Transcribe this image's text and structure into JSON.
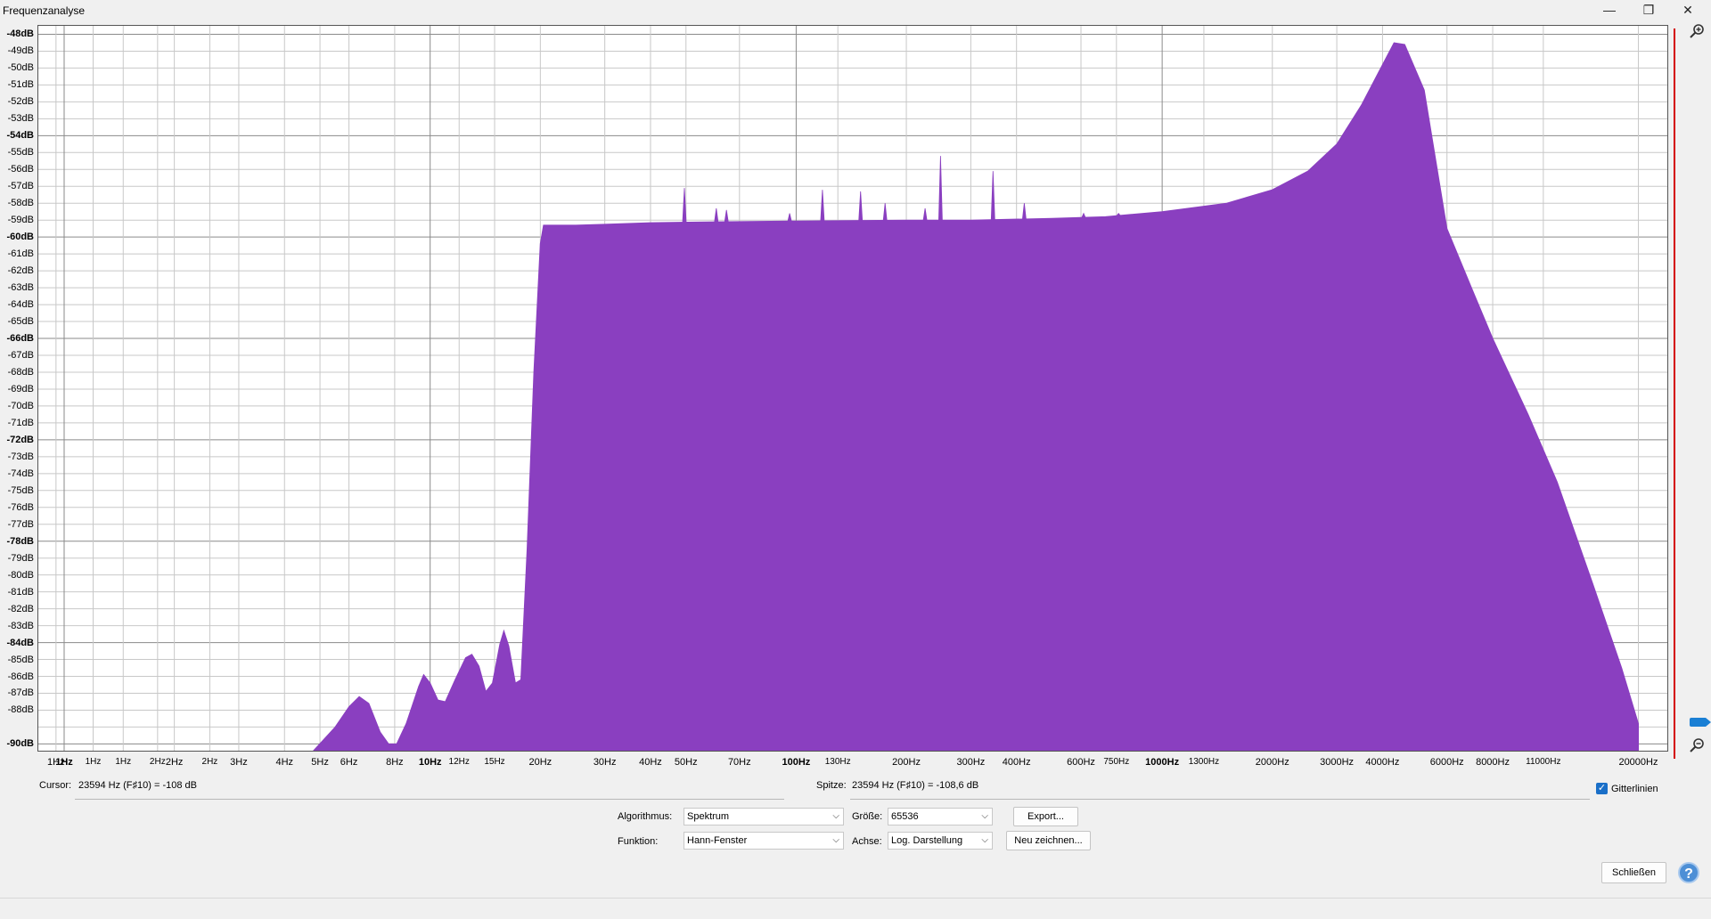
{
  "window": {
    "title": "Frequenzanalyse",
    "minimize_glyph": "—",
    "maximize_glyph": "❐",
    "close_glyph": "✕"
  },
  "chart_data": {
    "type": "area",
    "xscale": "log",
    "xlim": [
      0.85,
      24000
    ],
    "ylim": [
      -90.4,
      -47.5
    ],
    "grid": true,
    "fill_color": "#8a3fc0",
    "y_ticks": [
      "-48dB",
      "-49dB",
      "-50dB",
      "-51dB",
      "-52dB",
      "-53dB",
      "-54dB",
      "-55dB",
      "-56dB",
      "-57dB",
      "-58dB",
      "-59dB",
      "-60dB",
      "-61dB",
      "-62dB",
      "-63dB",
      "-64dB",
      "-65dB",
      "-66dB",
      "-67dB",
      "-68dB",
      "-69dB",
      "-70dB",
      "-71dB",
      "-72dB",
      "-73dB",
      "-74dB",
      "-75dB",
      "-76dB",
      "-77dB",
      "-78dB",
      "-79dB",
      "-80dB",
      "-81dB",
      "-82dB",
      "-83dB",
      "-84dB",
      "-85dB",
      "-86dB",
      "-87dB",
      "-88dB",
      "-90dB"
    ],
    "x_ticks": [
      {
        "f": 0.95,
        "label": "1Hz"
      },
      {
        "f": 1.0,
        "label": "1Hz",
        "major": true
      },
      {
        "f": 1.2,
        "label": "1Hz",
        "minor": true
      },
      {
        "f": 1.45,
        "label": "1Hz",
        "minor": true
      },
      {
        "f": 1.8,
        "label": "2Hz",
        "minor": true
      },
      {
        "f": 2.0,
        "label": "2Hz"
      },
      {
        "f": 2.5,
        "label": "2Hz",
        "minor": true
      },
      {
        "f": 3.0,
        "label": "3Hz"
      },
      {
        "f": 4.0,
        "label": "4Hz"
      },
      {
        "f": 5.0,
        "label": "5Hz"
      },
      {
        "f": 6.0,
        "label": "6Hz"
      },
      {
        "f": 8.0,
        "label": "8Hz"
      },
      {
        "f": 10,
        "label": "10Hz",
        "major": true
      },
      {
        "f": 12,
        "label": "12Hz",
        "minor": true
      },
      {
        "f": 15,
        "label": "15Hz",
        "minor": true
      },
      {
        "f": 20,
        "label": "20Hz"
      },
      {
        "f": 30,
        "label": "30Hz"
      },
      {
        "f": 40,
        "label": "40Hz"
      },
      {
        "f": 50,
        "label": "50Hz"
      },
      {
        "f": 70,
        "label": "70Hz"
      },
      {
        "f": 100,
        "label": "100Hz",
        "major": true
      },
      {
        "f": 130,
        "label": "130Hz",
        "minor": true
      },
      {
        "f": 200,
        "label": "200Hz"
      },
      {
        "f": 300,
        "label": "300Hz"
      },
      {
        "f": 400,
        "label": "400Hz"
      },
      {
        "f": 600,
        "label": "600Hz"
      },
      {
        "f": 750,
        "label": "750Hz",
        "minor": true
      },
      {
        "f": 1000,
        "label": "1000Hz",
        "major": true
      },
      {
        "f": 1300,
        "label": "1300Hz",
        "minor": true
      },
      {
        "f": 2000,
        "label": "2000Hz"
      },
      {
        "f": 3000,
        "label": "3000Hz"
      },
      {
        "f": 4000,
        "label": "4000Hz"
      },
      {
        "f": 6000,
        "label": "6000Hz"
      },
      {
        "f": 8000,
        "label": "8000Hz"
      },
      {
        "f": 11000,
        "label": "11000Hz",
        "minor": true
      },
      {
        "f": 20000,
        "label": "20000Hz"
      }
    ],
    "spectrum": [
      [
        4.8,
        -90.5
      ],
      [
        5.5,
        -89
      ],
      [
        6.0,
        -87.8
      ],
      [
        6.4,
        -87.2
      ],
      [
        6.8,
        -87.6
      ],
      [
        7.3,
        -89.3
      ],
      [
        7.7,
        -90.0
      ],
      [
        8.1,
        -90.0
      ],
      [
        8.6,
        -88.8
      ],
      [
        9.3,
        -86.6
      ],
      [
        9.6,
        -85.9
      ],
      [
        10.0,
        -86.4
      ],
      [
        10.5,
        -87.4
      ],
      [
        11.0,
        -87.5
      ],
      [
        11.7,
        -86.2
      ],
      [
        12.5,
        -84.9
      ],
      [
        13.0,
        -84.7
      ],
      [
        13.6,
        -85.4
      ],
      [
        14.2,
        -86.9
      ],
      [
        14.8,
        -86.4
      ],
      [
        15.5,
        -84.1
      ],
      [
        15.9,
        -83.3
      ],
      [
        16.4,
        -84.2
      ],
      [
        17.1,
        -86.4
      ],
      [
        17.7,
        -86.2
      ],
      [
        18.4,
        -78.5
      ],
      [
        19.2,
        -68
      ],
      [
        20.0,
        -60.4
      ],
      [
        20.4,
        -59.3
      ],
      [
        25,
        -59.3
      ],
      [
        30,
        -59.25
      ],
      [
        40,
        -59.15
      ],
      [
        60,
        -59.1
      ],
      [
        100,
        -59.05
      ],
      [
        200,
        -59.0
      ],
      [
        300,
        -59.0
      ],
      [
        500,
        -58.9
      ],
      [
        700,
        -58.8
      ],
      [
        1000,
        -58.5
      ],
      [
        1500,
        -58.0
      ],
      [
        2000,
        -57.2
      ],
      [
        2500,
        -56.1
      ],
      [
        3000,
        -54.5
      ],
      [
        3500,
        -52.2
      ],
      [
        4000,
        -49.8
      ],
      [
        4300,
        -48.5
      ],
      [
        4600,
        -48.6
      ],
      [
        5200,
        -51.3
      ],
      [
        6000,
        -59.5
      ],
      [
        7000,
        -63
      ],
      [
        8000,
        -66
      ],
      [
        10000,
        -70.5
      ],
      [
        12000,
        -74.5
      ],
      [
        15000,
        -80.5
      ],
      [
        18000,
        -85.5
      ],
      [
        20000,
        -88.8
      ],
      [
        20000,
        -90.5
      ]
    ],
    "peaks": [
      [
        49.5,
        -57.1
      ],
      [
        60.5,
        -58.3
      ],
      [
        64.5,
        -58.4
      ],
      [
        96,
        -58.6
      ],
      [
        118,
        -57.2
      ],
      [
        150,
        -57.3
      ],
      [
        175,
        -58.0
      ],
      [
        225,
        -58.3
      ],
      [
        248,
        -55.2
      ],
      [
        345,
        -56.1
      ],
      [
        420,
        -58.0
      ],
      [
        610,
        -58.6
      ],
      [
        760,
        -58.6
      ]
    ]
  },
  "info": {
    "cursor_label": "Cursor:",
    "cursor_value": "23594 Hz (F♯10) = -108 dB",
    "peak_label": "Spitze:",
    "peak_value": "23594 Hz (F♯10) = -108,6 dB",
    "gridlines_label": "Gitterlinien",
    "gridlines_checked": true
  },
  "controls": {
    "algorithm_label": "Algorithmus:",
    "algorithm_value": "Spektrum",
    "function_label": "Funktion:",
    "function_value": "Hann-Fenster",
    "size_label": "Größe:",
    "size_value": "65536",
    "axis_label": "Achse:",
    "axis_value": "Log. Darstellung",
    "export_button": "Export...",
    "replot_button": "Neu zeichnen...",
    "close_button": "Schließen",
    "help_glyph": "?"
  }
}
